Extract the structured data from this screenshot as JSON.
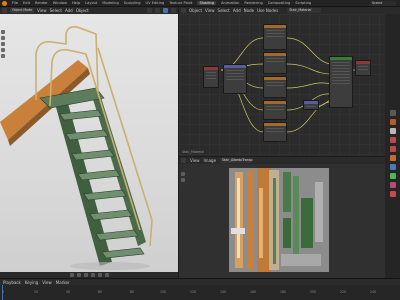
{
  "topbar": {
    "menus": [
      "File",
      "Edit",
      "Render",
      "Window",
      "Help"
    ],
    "workspaces": [
      "Layout",
      "Modeling",
      "Sculpting",
      "UV Editing",
      "Texture Paint",
      "Shading",
      "Animation",
      "Rendering",
      "Compositing",
      "Scripting"
    ],
    "active_workspace": "Shading",
    "scene": "Scene"
  },
  "viewport": {
    "mode": "Object Mode",
    "menus": [
      "View",
      "Select",
      "Add",
      "Object"
    ]
  },
  "node_editor": {
    "menus": [
      "Object",
      "View",
      "Select",
      "Add",
      "Node"
    ],
    "use_nodes": "Use Nodes",
    "material": "Stair_Material",
    "label": "Stair_Material"
  },
  "image_editor": {
    "menus": [
      "View",
      "Image"
    ],
    "image_name": "Stair_AlbedoTransp"
  },
  "timeline": {
    "menus": [
      "Playback",
      "Keying",
      "View",
      "Marker"
    ],
    "frames": [
      "0",
      "20",
      "40",
      "60",
      "80",
      "100",
      "120",
      "140",
      "160",
      "180",
      "200",
      "220",
      "240"
    ]
  },
  "colors": {
    "accent": "#e87d0d",
    "selection": "#4772b3",
    "shader_node": "#3a7a3a",
    "texture_node": "#a06a2a"
  }
}
